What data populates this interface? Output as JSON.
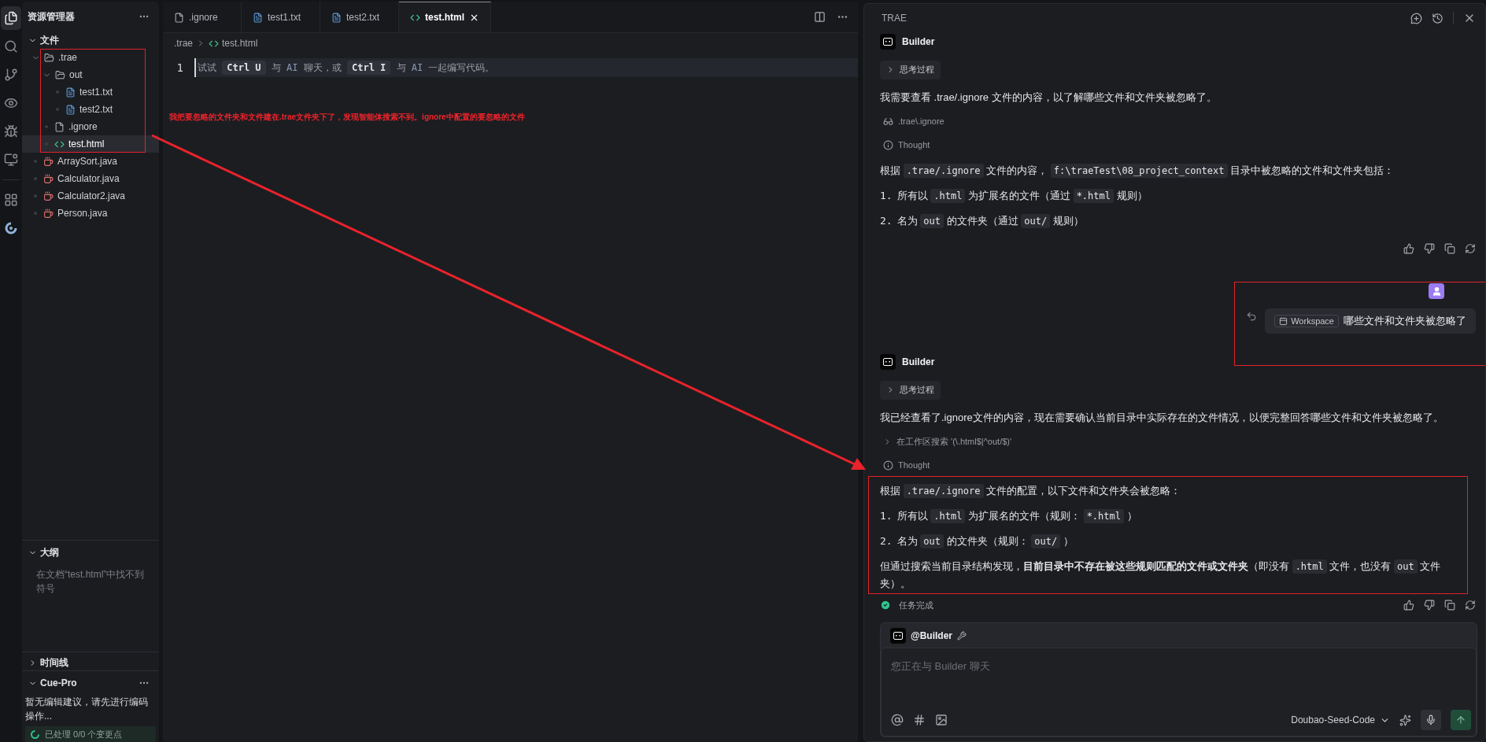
{
  "activity_bar": [
    {
      "kind": "files",
      "selected": true
    },
    {
      "kind": "search",
      "selected": false
    },
    {
      "kind": "source-control",
      "selected": false
    },
    {
      "kind": "preview",
      "selected": false
    },
    {
      "kind": "debug",
      "selected": false
    },
    {
      "kind": "remote",
      "selected": false
    },
    {
      "kind": "extensions",
      "selected": false
    },
    {
      "kind": "logo",
      "selected": false
    }
  ],
  "explorer": {
    "title": "资源管理器",
    "section": {
      "label": "文件",
      "expanded": true
    },
    "tree": [
      {
        "name": ".trae",
        "kind": "folder",
        "expanded": true,
        "selected": false,
        "highlighted": true,
        "children": [
          {
            "name": "out",
            "kind": "folder",
            "expanded": true,
            "selected": false,
            "children": [
              {
                "name": "test1.txt",
                "kind": "txt",
                "selected": false
              },
              {
                "name": "test2.txt",
                "kind": "txt",
                "selected": false
              }
            ]
          },
          {
            "name": ".ignore",
            "kind": "file",
            "selected": false
          },
          {
            "name": "test.html",
            "kind": "html",
            "selected": true
          }
        ]
      },
      {
        "name": "ArraySort.java",
        "kind": "java",
        "selected": false,
        "highlighted": false
      },
      {
        "name": "Calculator.java",
        "kind": "java",
        "selected": false,
        "highlighted": false
      },
      {
        "name": "Calculator2.java",
        "kind": "java",
        "selected": false,
        "highlighted": false
      },
      {
        "name": "Person.java",
        "kind": "java",
        "selected": false,
        "highlighted": false
      }
    ]
  },
  "outline": {
    "title": "大纲",
    "expanded": true,
    "message": "在文档“test.html”中找不到符号"
  },
  "timeline": {
    "title": "时间线",
    "expanded": false
  },
  "cue_pro": {
    "title": "Cue-Pro",
    "expanded": true,
    "message": "暂无编辑建议，请先进行编码操作...",
    "status": "已处理 0/0 个变更点"
  },
  "editor": {
    "tabs": [
      {
        "label": ".ignore",
        "kind": "file",
        "selected": false
      },
      {
        "label": "test1.txt",
        "kind": "txt",
        "selected": false
      },
      {
        "label": "test2.txt",
        "kind": "txt",
        "selected": false
      },
      {
        "label": "test.html",
        "kind": "html",
        "selected": true
      }
    ],
    "breadcrumb": [
      {
        "label": ".trae",
        "kind": "folder"
      },
      {
        "label": "test.html",
        "kind": "html"
      }
    ],
    "lines": [
      {
        "number": "1",
        "segments": [
          {
            "kind": "text",
            "text": "试试 "
          },
          {
            "kind": "key",
            "text": "Ctrl U"
          },
          {
            "kind": "text",
            "text": " 与 "
          },
          {
            "kind": "ai",
            "text": "AI"
          },
          {
            "kind": "text",
            "text": " 聊天，或 "
          },
          {
            "kind": "key",
            "text": "Ctrl I"
          },
          {
            "kind": "text",
            "text": " 与 "
          },
          {
            "kind": "ai",
            "text": "AI"
          },
          {
            "kind": "text",
            "text": " 一起编写代码。"
          }
        ]
      }
    ],
    "annotation": "我把要忽略的文件夹和文件建在.trae文件夹下了，发现智能体搜索不到。ignore中配置的要忽略的文件"
  },
  "chat": {
    "title": "TRAE",
    "blocks": [
      {
        "kind": "agent",
        "name": "Builder",
        "highlighted": false
      },
      {
        "kind": "thinking",
        "label": "思考过程",
        "expanded": false,
        "highlighted": false
      },
      {
        "kind": "paragraph",
        "highlighted": false,
        "segments": [
          {
            "kind": "text",
            "text": "我需要查看 .trae/.ignore 文件的内容，以了解哪些文件和文件夹被忽略了。"
          }
        ]
      },
      {
        "kind": "read",
        "text": ".trae\\.ignore",
        "highlighted": false
      },
      {
        "kind": "thought",
        "text": "Thought",
        "highlighted": false
      },
      {
        "kind": "paragraph",
        "highlighted": false,
        "segments": [
          {
            "kind": "text",
            "text": "根据 "
          },
          {
            "kind": "code",
            "text": ".trae/.ignore"
          },
          {
            "kind": "text",
            "text": " 文件的内容， "
          },
          {
            "kind": "code",
            "text": "f:\\traeTest\\08_project_context"
          },
          {
            "kind": "text",
            "text": " 目录中被忽略的文件和文件夹包括："
          }
        ]
      },
      {
        "kind": "list-item",
        "number": "1.",
        "highlighted": false,
        "segments": [
          {
            "kind": "text",
            "text": "所有以 "
          },
          {
            "kind": "code",
            "text": ".html"
          },
          {
            "kind": "text",
            "text": " 为扩展名的文件（通过 "
          },
          {
            "kind": "code",
            "text": "*.html"
          },
          {
            "kind": "text",
            "text": " 规则）"
          }
        ]
      },
      {
        "kind": "list-item",
        "number": "2.",
        "highlighted": false,
        "segments": [
          {
            "kind": "text",
            "text": "名为 "
          },
          {
            "kind": "code",
            "text": "out"
          },
          {
            "kind": "text",
            "text": " 的文件夹（通过 "
          },
          {
            "kind": "code",
            "text": "out/"
          },
          {
            "kind": "text",
            "text": " 规则）"
          }
        ]
      },
      {
        "kind": "actions",
        "highlighted": false
      },
      {
        "kind": "user",
        "context": "Workspace",
        "text": "哪些文件和文件夹被忽略了",
        "highlighted": true
      },
      {
        "kind": "agent",
        "name": "Builder",
        "highlighted": false
      },
      {
        "kind": "thinking",
        "label": "思考过程",
        "expanded": false,
        "highlighted": false
      },
      {
        "kind": "paragraph",
        "highlighted": false,
        "segments": [
          {
            "kind": "text",
            "text": "我已经查看了.ignore文件的内容，现在需要确认当前目录中实际存在的文件情况，以便完整回答哪些文件和文件夹被忽略了。"
          }
        ]
      },
      {
        "kind": "search",
        "text": "在工作区搜索 '(\\.html$|^out/$)'",
        "expanded": false,
        "highlighted": false
      },
      {
        "kind": "thought",
        "text": "Thought",
        "highlighted": false
      },
      {
        "kind": "paragraph",
        "highlighted": true,
        "segments": [
          {
            "kind": "text",
            "text": "根据 "
          },
          {
            "kind": "code",
            "text": ".trae/.ignore"
          },
          {
            "kind": "text",
            "text": " 文件的配置，以下文件和文件夹会被忽略："
          }
        ]
      },
      {
        "kind": "list-item",
        "number": "1.",
        "highlighted": true,
        "segments": [
          {
            "kind": "text",
            "text": "所有以 "
          },
          {
            "kind": "code",
            "text": ".html"
          },
          {
            "kind": "text",
            "text": " 为扩展名的文件（规则： "
          },
          {
            "kind": "code",
            "text": "*.html"
          },
          {
            "kind": "text",
            "text": " ）"
          }
        ]
      },
      {
        "kind": "list-item",
        "number": "2.",
        "highlighted": true,
        "segments": [
          {
            "kind": "text",
            "text": "名为 "
          },
          {
            "kind": "code",
            "text": "out"
          },
          {
            "kind": "text",
            "text": " 的文件夹（规则： "
          },
          {
            "kind": "code",
            "text": "out/"
          },
          {
            "kind": "text",
            "text": " ）"
          }
        ]
      },
      {
        "kind": "paragraph",
        "highlighted": true,
        "segments": [
          {
            "kind": "text",
            "text": "但通过搜索当前目录结构发现，"
          },
          {
            "kind": "bold",
            "text": "目前目录中不存在被这些规则匹配的文件或文件夹"
          },
          {
            "kind": "text",
            "text": "（即没有 "
          },
          {
            "kind": "code",
            "text": ".html"
          },
          {
            "kind": "text",
            "text": " 文件，也没有 "
          },
          {
            "kind": "code",
            "text": "out"
          },
          {
            "kind": "text",
            "text": " 文件夹）。"
          }
        ]
      },
      {
        "kind": "status",
        "text": "任务完成",
        "highlighted": false
      }
    ],
    "input": {
      "agent": "@Builder",
      "placeholder": "您正在与 Builder 聊天",
      "model": "Doubao-Seed-Code"
    }
  }
}
